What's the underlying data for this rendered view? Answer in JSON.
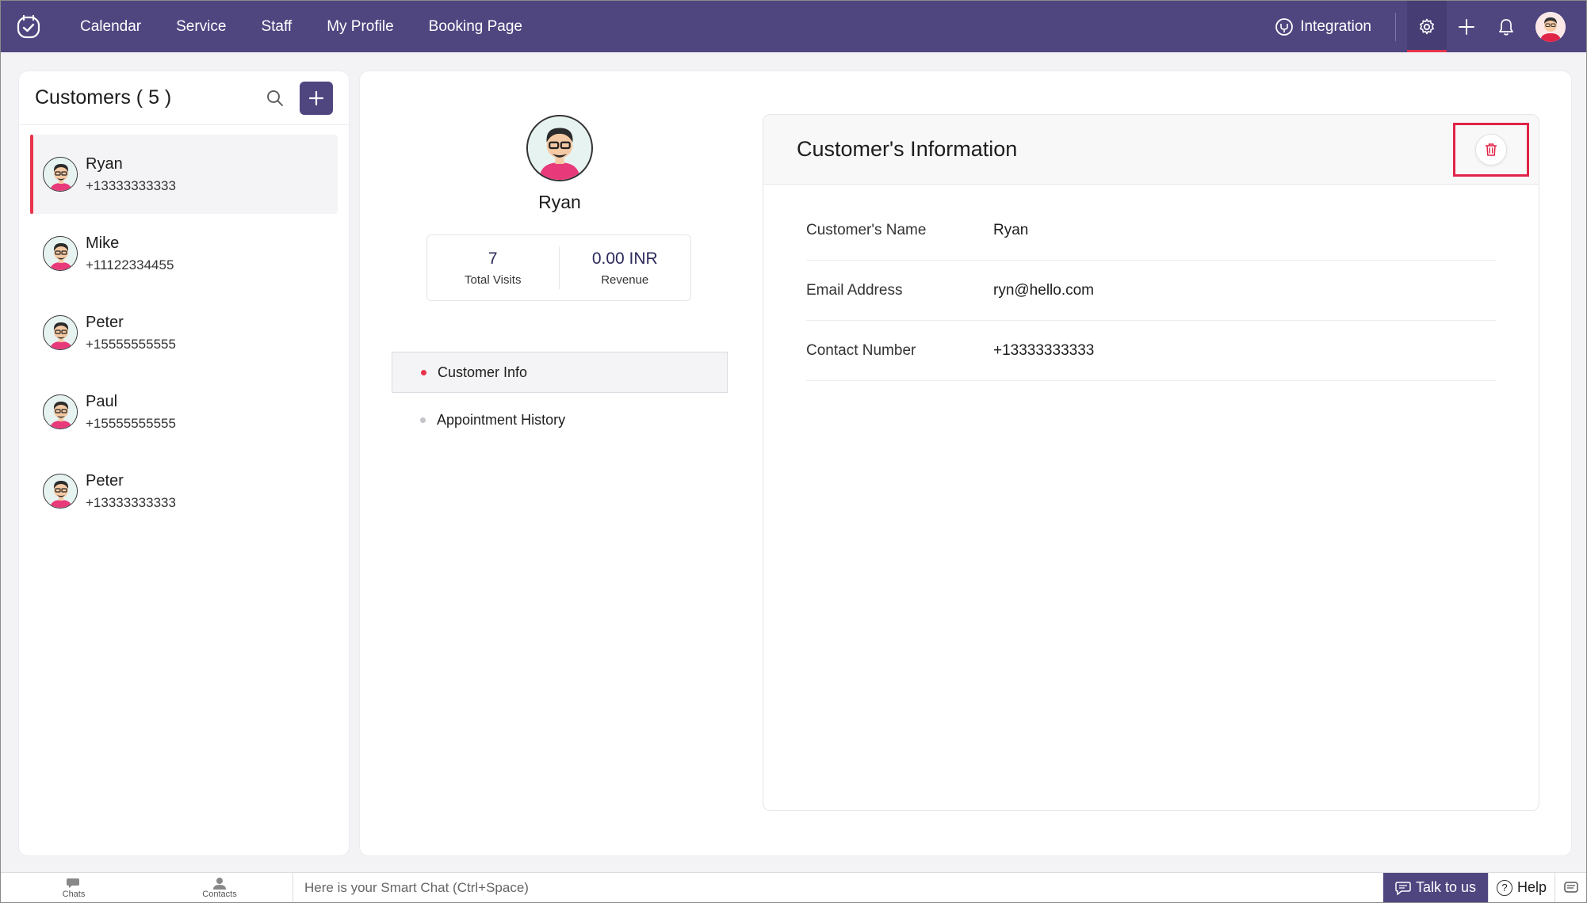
{
  "topbar": {
    "nav": [
      {
        "label": "Calendar"
      },
      {
        "label": "Service"
      },
      {
        "label": "Staff"
      },
      {
        "label": "My Profile"
      },
      {
        "label": "Booking Page"
      }
    ],
    "integration_label": "Integration",
    "icons": [
      "app-logo-icon",
      "integration-icon",
      "gear-icon",
      "plus-icon",
      "bell-icon",
      "user-avatar"
    ]
  },
  "customers": {
    "title": "Customers ( 5 )",
    "items": [
      {
        "name": "Ryan",
        "phone": "+13333333333"
      },
      {
        "name": "Mike",
        "phone": "+11122334455"
      },
      {
        "name": "Peter",
        "phone": "+15555555555"
      },
      {
        "name": "Paul",
        "phone": "+15555555555"
      },
      {
        "name": "Peter",
        "phone": "+13333333333"
      }
    ]
  },
  "profile": {
    "name": "Ryan",
    "stats": [
      {
        "value": "7",
        "label": "Total Visits"
      },
      {
        "value": "0.00 INR",
        "label": "Revenue"
      }
    ],
    "menu": [
      {
        "label": "Customer Info"
      },
      {
        "label": "Appointment History"
      }
    ]
  },
  "info": {
    "title": "Customer's Information",
    "rows": [
      {
        "key": "Customer's Name",
        "value": "Ryan"
      },
      {
        "key": "Email Address",
        "value": "ryn@hello.com"
      },
      {
        "key": "Contact Number",
        "value": "+13333333333"
      }
    ]
  },
  "bottombar": {
    "chats_label": "Chats",
    "contacts_label": "Contacts",
    "chat_placeholder": "Here is your Smart Chat (Ctrl+Space)",
    "talk_label": "Talk to us",
    "help_label": "Help"
  },
  "colors": {
    "brand": "#4f4680",
    "accent": "#e8334a"
  }
}
